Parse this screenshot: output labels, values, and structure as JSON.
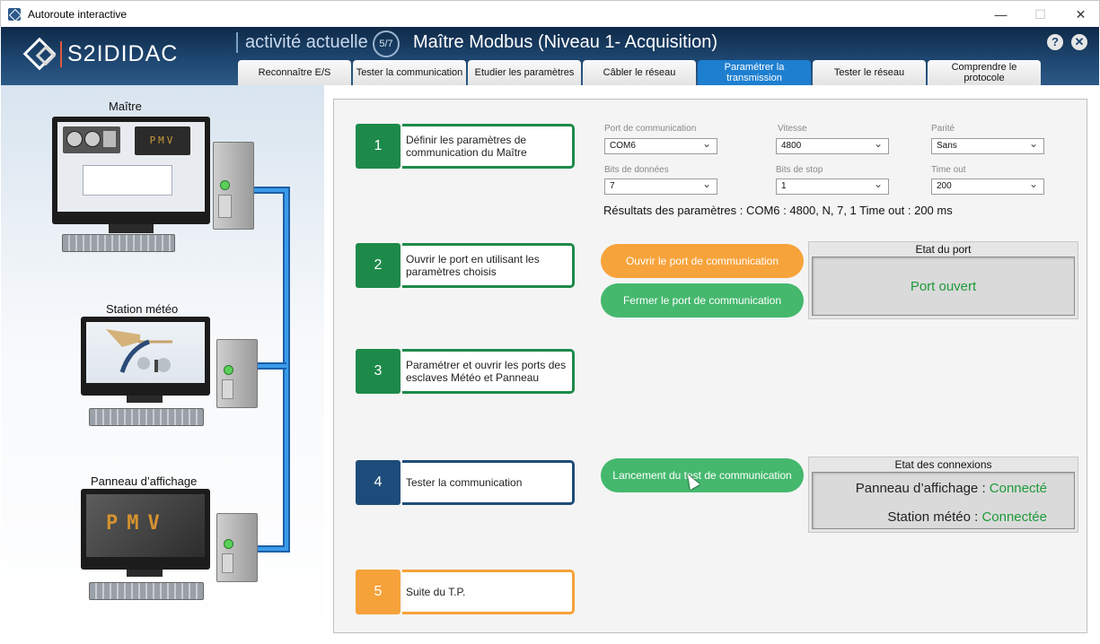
{
  "window": {
    "title": "Autoroute interactive",
    "minimize": "—",
    "maximize": "☐",
    "close": "✕"
  },
  "header": {
    "logo_text": "S2IDIDAC",
    "activity_label": "activité actuelle",
    "step_badge": "5/7",
    "title": "Maître Modbus (Niveau 1- Acquisition)",
    "help": "?",
    "close": "✕"
  },
  "tabs": [
    {
      "label": "Reconnaître E/S"
    },
    {
      "label": "Tester la communication"
    },
    {
      "label": "Etudier les paramètres"
    },
    {
      "label": "Câbler le réseau"
    },
    {
      "label": "Paramétrer la transmission"
    },
    {
      "label": "Tester le réseau"
    },
    {
      "label": "Comprendre le protocole"
    }
  ],
  "stations": {
    "master": "Maître",
    "weather": "Station météo",
    "panel": "Panneau d’affichage",
    "panel_display": "PMV",
    "master_display": "PMV"
  },
  "steps": [
    {
      "num": "1",
      "text": "Définir les paramètres de communication du Maître"
    },
    {
      "num": "2",
      "text": "Ouvrir le port en utilisant les paramètres choisis"
    },
    {
      "num": "3",
      "text": "Paramétrer et ouvrir les ports des esclaves Météo et Panneau"
    },
    {
      "num": "4",
      "text": "Tester la communication"
    },
    {
      "num": "5",
      "text": "Suite du T.P."
    }
  ],
  "params": {
    "port": {
      "label": "Port de communication",
      "value": "COM6"
    },
    "speed": {
      "label": "Vitesse",
      "value": "4800"
    },
    "parity": {
      "label": "Parité",
      "value": "Sans"
    },
    "data_bits": {
      "label": "Bits de données",
      "value": "7"
    },
    "stop_bits": {
      "label": "Bits de stop",
      "value": "1"
    },
    "timeout": {
      "label": "Time out",
      "value": "200"
    },
    "results": "Résultats des paramètres : COM6 : 4800, N, 7, 1 Time out : 200 ms"
  },
  "port_actions": {
    "open_label": "Ouvrir le port de communication",
    "close_label": "Fermer le port de communication"
  },
  "port_state": {
    "title": "Etat du port",
    "value": "Port ouvert"
  },
  "test": {
    "launch_label": "Lancement du test de communication"
  },
  "connections": {
    "title": "Etat des connexions",
    "panel_label": "Panneau d’affichage :",
    "panel_value": "Connecté",
    "weather_label": "Station météo :",
    "weather_value": "Connectée"
  },
  "colors": {
    "header": "#1e4670",
    "active_tab": "#1e7fd0",
    "green": "#1d8a4a",
    "blue": "#1e4c7a",
    "orange": "#f6a23a",
    "status_green": "#1e9a3a",
    "bus_blue": "#1976d2"
  }
}
